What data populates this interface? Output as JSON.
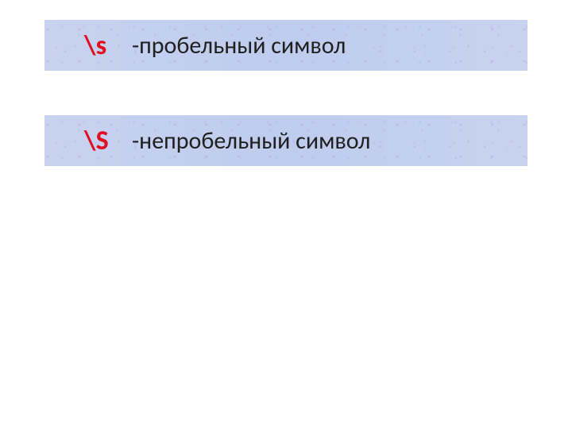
{
  "entries": [
    {
      "symbol": "\\s",
      "description": "-пробельный символ"
    },
    {
      "symbol": "\\S",
      "description": "-непробельный символ"
    }
  ]
}
